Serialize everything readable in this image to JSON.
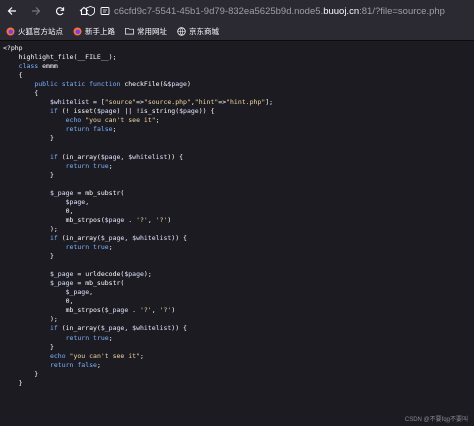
{
  "browser": {
    "url_prefix": "c6cfd9c7-5541-45b1-9d79-832ea5625b9d.node5.",
    "url_host": "buuoj.cn",
    "url_suffix": ":81/?file=source.php"
  },
  "bookmarks": [
    {
      "label": "火狐官方站点",
      "icon": "firefox-icon"
    },
    {
      "label": "新手上路",
      "icon": "firefox-icon"
    },
    {
      "label": "常用网址",
      "icon": "folder-icon"
    },
    {
      "label": "京东商城",
      "icon": "globe-icon"
    }
  ],
  "code_lines": [
    "<?php",
    "    highlight_file(__FILE__);",
    "    class emmm",
    "    {",
    "        public static function checkFile(&$page)",
    "        {",
    "            $whitelist = [\"source\"=>\"source.php\",\"hint\"=>\"hint.php\"];",
    "            if (! isset($page) || !is_string($page)) {",
    "                echo \"you can't see it\";",
    "                return false;",
    "            }",
    "",
    "            if (in_array($page, $whitelist)) {",
    "                return true;",
    "            }",
    "",
    "            $_page = mb_substr(",
    "                $page,",
    "                0,",
    "                mb_strpos($page . '?', '?')",
    "            );",
    "            if (in_array($_page, $whitelist)) {",
    "                return true;",
    "            }",
    "",
    "            $_page = urldecode($page);",
    "            $_page = mb_substr(",
    "                $_page,",
    "                0,",
    "                mb_strpos($_page . '?', '?')",
    "            );",
    "            if (in_array($_page, $whitelist)) {",
    "                return true;",
    "            }",
    "            echo \"you can't see it\";",
    "            return false;",
    "        }",
    "    }"
  ],
  "watermark": "CSDN @不要fqg不要叫"
}
